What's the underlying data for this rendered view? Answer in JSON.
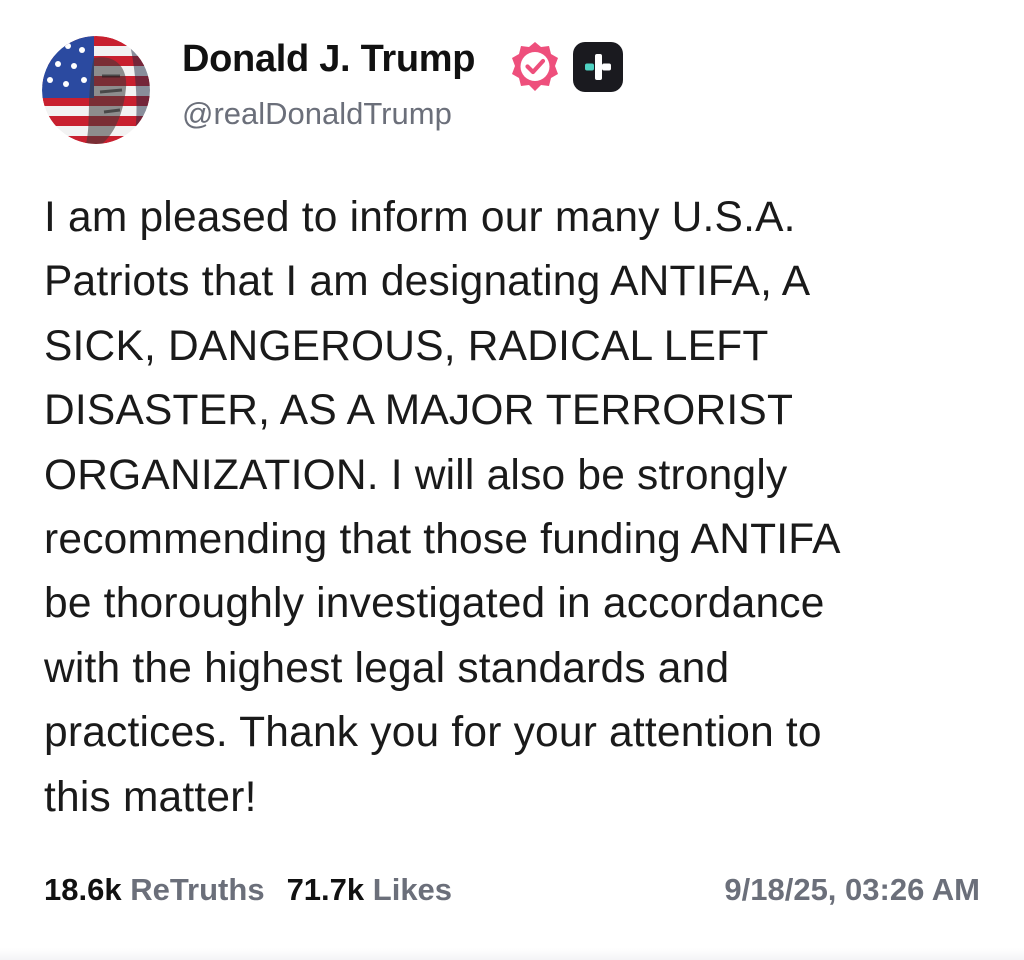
{
  "author": {
    "name": "Donald J. Trump",
    "handle": "@realDonaldTrump",
    "verified": true,
    "verified_badge_color": "#ee4f7c"
  },
  "post": {
    "lines": [
      "I am pleased to inform our many U.S.A.",
      "Patriots that I am designating ANTIFA, A",
      "SICK, DANGEROUS, RADICAL LEFT",
      "DISASTER, AS A MAJOR TERRORIST",
      "ORGANIZATION. I will also be strongly",
      "recommending that those funding ANTIFA",
      "be thoroughly investigated in accordance",
      "with the highest legal standards and",
      "practices. Thank you for your attention to",
      "this matter!"
    ]
  },
  "stats": {
    "retruths_count": "18.6k",
    "retruths_label": "ReTruths",
    "likes_count": "71.7k",
    "likes_label": "Likes"
  },
  "timestamp": "9/18/25, 03:26 AM",
  "icons": {
    "avatar": "avatar-flag-portrait",
    "verified": "verified-badge-icon",
    "plus": "plus-badge-icon"
  }
}
